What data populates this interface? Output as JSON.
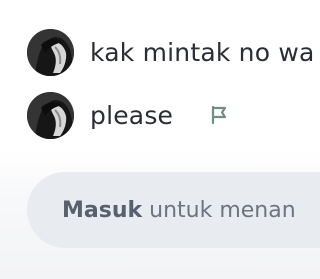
{
  "comments": [
    {
      "avatar_icon": "user-avatar-dark-hair",
      "text": "kak mintak no wa"
    },
    {
      "avatar_icon": "user-avatar-dark-hair",
      "text": "please",
      "action_icon": "flag-icon"
    }
  ],
  "comment_input": {
    "link_label": "Masuk",
    "prompt_text": "untuk menan"
  },
  "colors": {
    "text": "#2a2d34",
    "flag_icon": "#6f8f86",
    "input_bg": "#e8ebf0",
    "input_text": "#6c7482"
  }
}
